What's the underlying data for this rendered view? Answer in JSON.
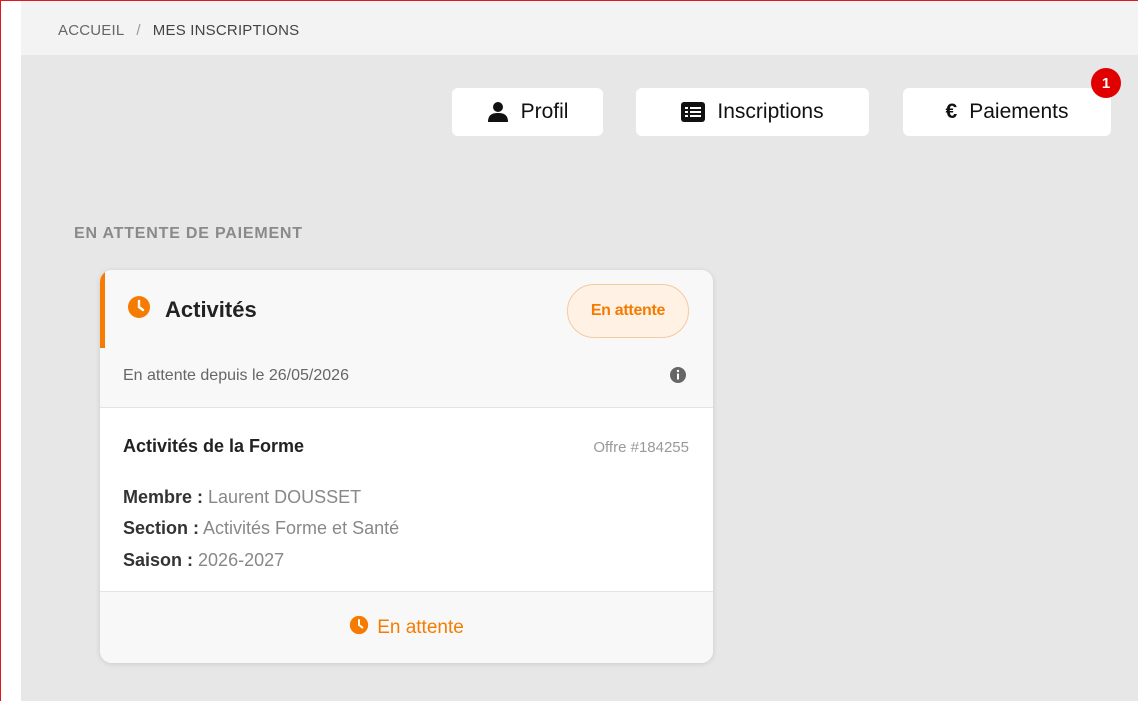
{
  "breadcrumb": {
    "home": "ACCUEIL",
    "separator": "/",
    "current": "MES INSCRIPTIONS"
  },
  "nav": {
    "profil": {
      "label": "Profil",
      "icon": "user-icon"
    },
    "inscriptions": {
      "label": "Inscriptions",
      "icon": "list-icon"
    },
    "paiements": {
      "label": "Paiements",
      "icon": "euro-icon",
      "symbol": "€",
      "badge": "1"
    }
  },
  "section": {
    "title": "EN ATTENTE DE PAIEMENT"
  },
  "card": {
    "title": "Activités",
    "status": "En attente",
    "since": "En attente depuis le 26/05/2026",
    "offer_name": "Activités de la Forme",
    "offer_ref": "Offre #184255",
    "member_label": "Membre :",
    "member_value": "Laurent DOUSSET",
    "section_label": "Section :",
    "section_value": "Activités Forme et Santé",
    "season_label": "Saison :",
    "season_value": "2026-2027",
    "footer_status": "En attente"
  },
  "colors": {
    "accent": "#f57c00",
    "badge": "#e10000",
    "background": "#e7e7e7"
  }
}
